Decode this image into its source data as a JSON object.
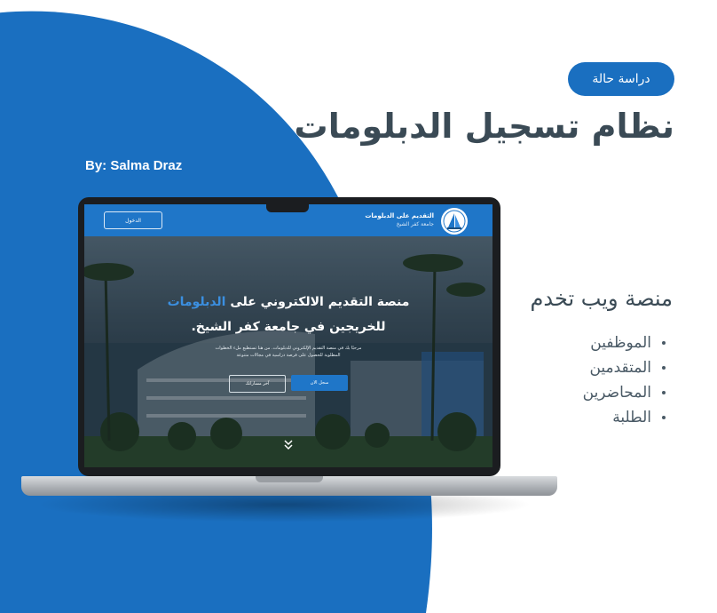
{
  "badge": "دراسة حالة",
  "title": "نظام تسجيل الدبلومات",
  "author": "By: Salma Draz",
  "subtitle": "منصة ويب تخدم",
  "audience": [
    "الموظفين",
    "المتقدمين",
    "المحاضرين",
    "الطلبة"
  ],
  "site": {
    "nav_login": "الدخول",
    "brand_name": "التقديم على الدبلومات",
    "brand_sub": "جامعة كفر الشيخ",
    "hero_line1_start": "منصة التقديم الالكتروني على ",
    "hero_line1_accent": "الدبلومات",
    "hero_line2": "للخريجين في جامعة كفر الشيخ.",
    "hero_desc": "مرحبًا بك في منصة التقديم الإلكتروني للدبلومات. من هنا تستطيع ملء الخطوات المطلوبة للحصول على فرصة دراسية في مجالات متنوعة",
    "btn_primary": "سجل الان",
    "btn_outline": "آخر مساراتك"
  },
  "colors": {
    "brand_blue": "#1a6fc0",
    "text_dark": "#3a4a55",
    "accent": "#3b8fe0"
  },
  "icons": {
    "scroll": "double-chevron-down-icon",
    "logo": "university-logo"
  }
}
